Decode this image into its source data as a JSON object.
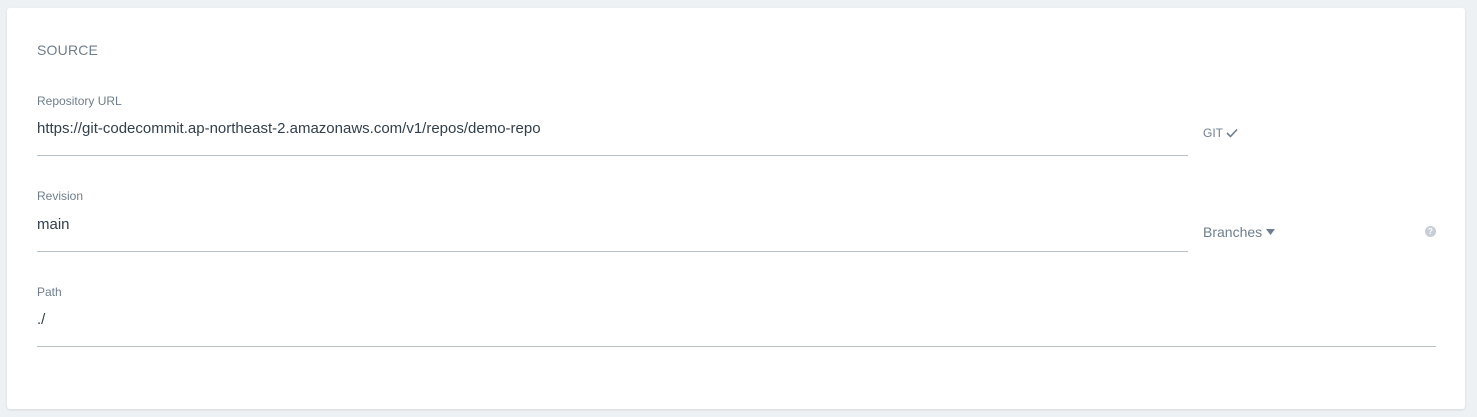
{
  "source": {
    "title": "SOURCE",
    "repository": {
      "label": "Repository URL",
      "value": "https://git-codecommit.ap-northeast-2.amazonaws.com/v1/repos/demo-repo",
      "type_label": "GIT",
      "type_icon": "check-icon"
    },
    "revision": {
      "label": "Revision",
      "value": "main",
      "dropdown_label": "Branches",
      "dropdown_icon": "caret-down-icon",
      "help_icon": "help-icon"
    },
    "path": {
      "label": "Path",
      "value": "./"
    }
  }
}
